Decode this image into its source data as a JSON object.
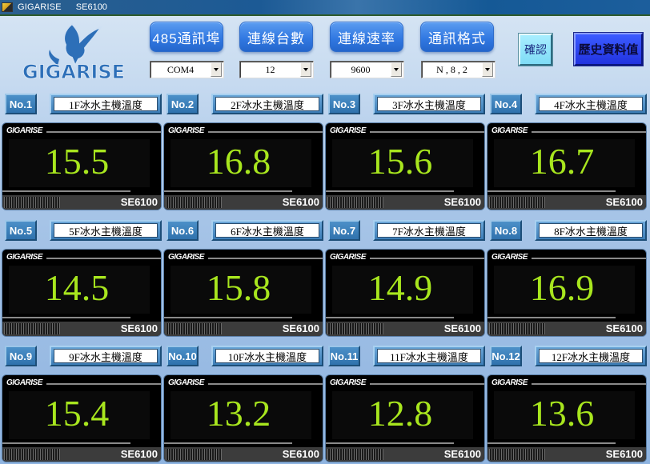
{
  "window": {
    "title": "GIGARISE",
    "subtitle": "SE6100"
  },
  "logo": {
    "text": "GIGARISE"
  },
  "header": {
    "buttons": [
      {
        "label": "485通訊埠",
        "select_value": "COM4"
      },
      {
        "label": "連線台數",
        "select_value": "12"
      },
      {
        "label": "連線速率",
        "select_value": "9600"
      },
      {
        "label": "通訊格式",
        "select_value": "N , 8 , 2"
      }
    ],
    "confirm_label": "確認",
    "history_label": "歷史資料值"
  },
  "meters": [
    {
      "no": "No.1",
      "name": "1F冰水主機溫度",
      "value": "15.5",
      "brand": "GIGARISE",
      "model": "SE6100"
    },
    {
      "no": "No.2",
      "name": "2F冰水主機溫度",
      "value": "16.8",
      "brand": "GIGARISE",
      "model": "SE6100"
    },
    {
      "no": "No.3",
      "name": "3F冰水主機溫度",
      "value": "15.6",
      "brand": "GIGARISE",
      "model": "SE6100"
    },
    {
      "no": "No.4",
      "name": "4F冰水主機溫度",
      "value": "16.7",
      "brand": "GIGARISE",
      "model": "SE6100"
    },
    {
      "no": "No.5",
      "name": "5F冰水主機溫度",
      "value": "14.5",
      "brand": "GIGARISE",
      "model": "SE6100"
    },
    {
      "no": "No.6",
      "name": "6F冰水主機溫度",
      "value": "15.8",
      "brand": "GIGARISE",
      "model": "SE6100"
    },
    {
      "no": "No.7",
      "name": "7F冰水主機溫度",
      "value": "14.9",
      "brand": "GIGARISE",
      "model": "SE6100"
    },
    {
      "no": "No.8",
      "name": "8F冰水主機溫度",
      "value": "16.9",
      "brand": "GIGARISE",
      "model": "SE6100"
    },
    {
      "no": "No.9",
      "name": "9F冰水主機溫度",
      "value": "15.4",
      "brand": "GIGARISE",
      "model": "SE6100"
    },
    {
      "no": "No.10",
      "name": "10F冰水主機溫度",
      "value": "13.2",
      "brand": "GIGARISE",
      "model": "SE6100"
    },
    {
      "no": "No.11",
      "name": "11F冰水主機溫度",
      "value": "12.8",
      "brand": "GIGARISE",
      "model": "SE6100"
    },
    {
      "no": "No.12",
      "name": "12F冰水主機溫度",
      "value": "13.6",
      "brand": "GIGARISE",
      "model": "SE6100"
    }
  ],
  "colors": {
    "value_text": "#a8e61e",
    "header_button": "#3279e2",
    "history_button": "#2233e0",
    "confirm_button": "#7fdcf6"
  }
}
